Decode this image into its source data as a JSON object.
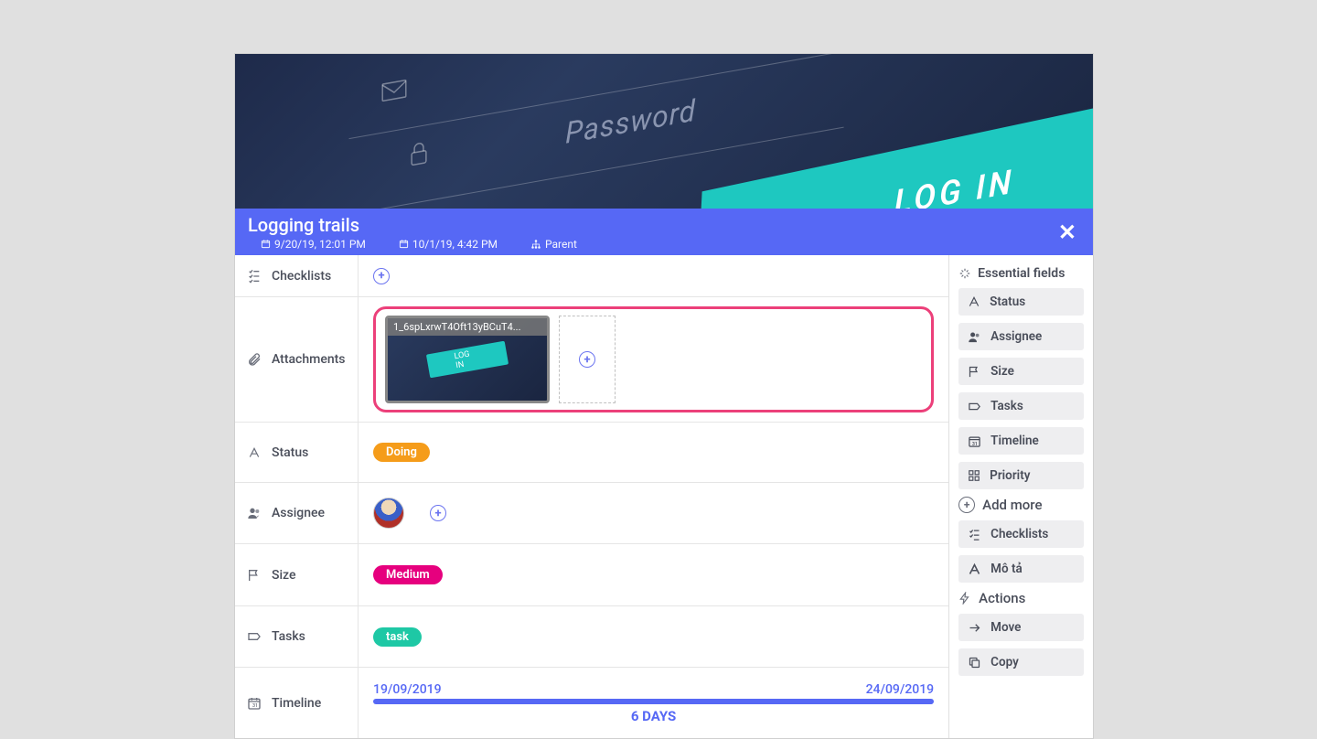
{
  "title": "Logging trails",
  "meta": {
    "created": "9/20/19, 12:01 PM",
    "due": "10/1/19, 4:42 PM",
    "parent_label": "Parent"
  },
  "cover": {
    "password_label": "Password",
    "login_label": "LOG IN"
  },
  "sections": {
    "checklists": "Checklists",
    "attachments": "Attachments",
    "status": "Status",
    "assignee": "Assignee",
    "size": "Size",
    "tasks": "Tasks",
    "timeline": "Timeline"
  },
  "attachments": [
    {
      "filename": "1_6spLxrwT4Oft13yBCuT4...",
      "thumb_btn": "LOG IN"
    }
  ],
  "status_value": "Doing",
  "size_value": "Medium",
  "tasks_value": "task",
  "timeline": {
    "start": "19/09/2019",
    "end": "24/09/2019",
    "duration": "6 DAYS"
  },
  "sidebar": {
    "essential_heading": "Essential fields",
    "essential": [
      {
        "id": "status",
        "label": "Status"
      },
      {
        "id": "assignee",
        "label": "Assignee"
      },
      {
        "id": "size",
        "label": "Size"
      },
      {
        "id": "tasks",
        "label": "Tasks"
      },
      {
        "id": "timeline",
        "label": "Timeline"
      },
      {
        "id": "priority",
        "label": "Priority"
      }
    ],
    "addmore_heading": "Add more",
    "addmore": [
      {
        "id": "checklists",
        "label": "Checklists"
      },
      {
        "id": "mota",
        "label": "Mô tả"
      }
    ],
    "actions_heading": "Actions",
    "actions": [
      {
        "id": "move",
        "label": "Move"
      },
      {
        "id": "copy",
        "label": "Copy"
      }
    ]
  }
}
